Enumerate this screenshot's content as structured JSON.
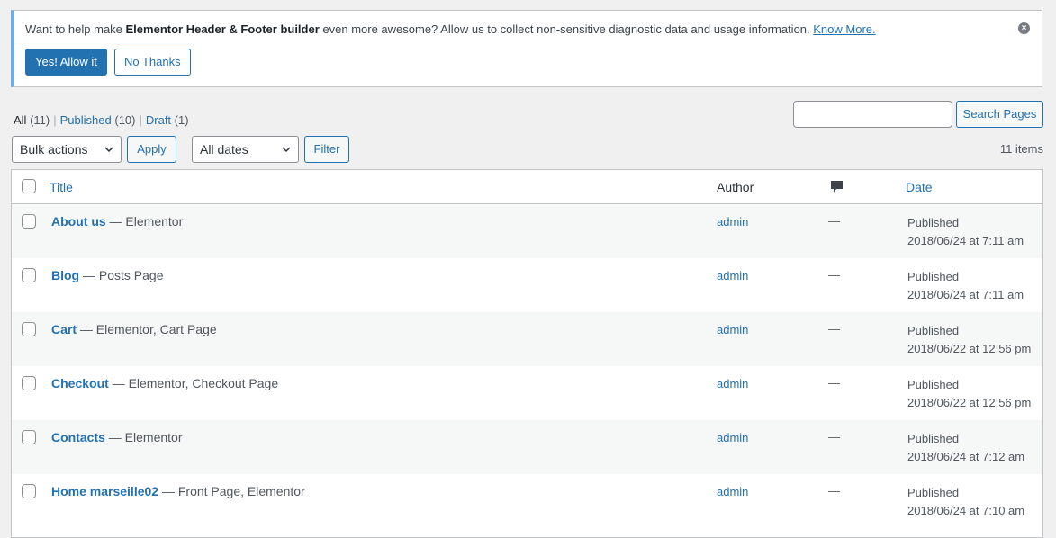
{
  "notice": {
    "text_before": "Want to help make ",
    "text_bold": "Elementor Header & Footer builder",
    "text_after": " even more awesome? Allow us to collect non-sensitive diagnostic data and usage information. ",
    "link": "Know More.",
    "allow_button": "Yes! Allow it",
    "decline_button": "No Thanks"
  },
  "views": [
    {
      "label": "All",
      "count": "(11)"
    },
    {
      "label": "Published",
      "count": "(10)"
    },
    {
      "label": "Draft",
      "count": "(1)"
    }
  ],
  "search": {
    "value": "",
    "button": "Search Pages"
  },
  "bulk": {
    "selected": "Bulk actions",
    "apply": "Apply"
  },
  "dates": {
    "selected": "All dates",
    "filter": "Filter"
  },
  "items_count": "11 items",
  "table": {
    "columns": {
      "title": "Title",
      "author": "Author",
      "date": "Date"
    },
    "rows": [
      {
        "title": "About us",
        "states": " — Elementor",
        "author": "admin",
        "comments": "—",
        "status": "Published",
        "date": "2018/06/24 at 7:11 am"
      },
      {
        "title": "Blog",
        "states": " — Posts Page",
        "author": "admin",
        "comments": "—",
        "status": "Published",
        "date": "2018/06/24 at 7:11 am"
      },
      {
        "title": "Cart",
        "states": " — Elementor, Cart Page",
        "author": "admin",
        "comments": "—",
        "status": "Published",
        "date": "2018/06/22 at 12:56 pm"
      },
      {
        "title": "Checkout",
        "states": " — Elementor, Checkout Page",
        "author": "admin",
        "comments": "—",
        "status": "Published",
        "date": "2018/06/22 at 12:56 pm"
      },
      {
        "title": "Contacts",
        "states": " — Elementor",
        "author": "admin",
        "comments": "—",
        "status": "Published",
        "date": "2018/06/24 at 7:12 am"
      },
      {
        "title": "Home marseille02",
        "states": " — Front Page, Elementor",
        "author": "admin",
        "comments": "—",
        "status": "Published",
        "date": "2018/06/24 at 7:10 am"
      }
    ]
  },
  "colors": {
    "link": "#2271b1",
    "notice_border": "#72aee6",
    "primary": "#2271b1"
  },
  "icons": {
    "comments_header": "comment-bubble-icon",
    "dismiss": "close-circle-icon",
    "select": "chevron-down-icon"
  }
}
